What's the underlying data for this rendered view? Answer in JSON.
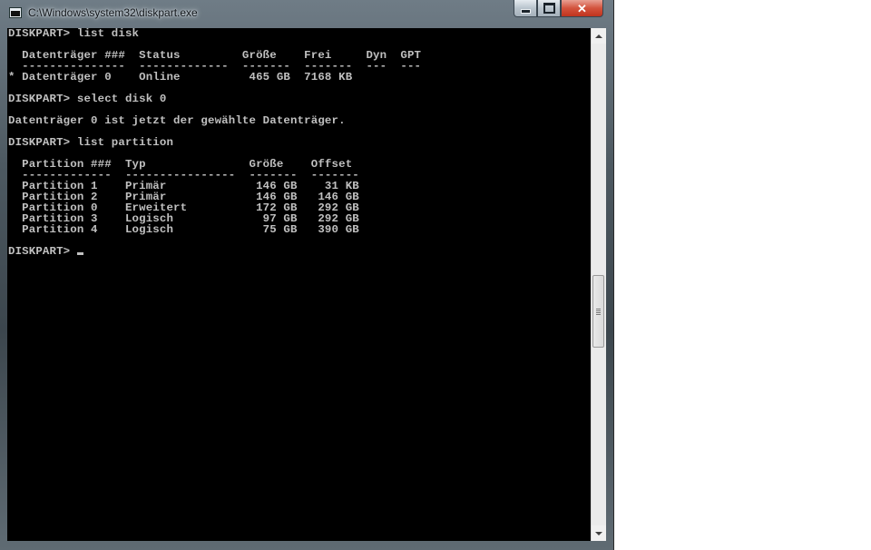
{
  "window": {
    "title": "C:\\Windows\\system32\\diskpart.exe",
    "controls": {
      "minimize": "minimize",
      "maximize": "maximize",
      "close": "✕"
    }
  },
  "console": {
    "lines": [
      "DISKPART> list disk",
      "",
      "  Datenträger ###  Status         Größe    Frei     Dyn  GPT",
      "  ---------------  -------------  -------  -------  ---  ---",
      "* Datenträger 0    Online          465 GB  7168 KB",
      "",
      "DISKPART> select disk 0",
      "",
      "Datenträger 0 ist jetzt der gewählte Datenträger.",
      "",
      "DISKPART> list partition",
      "",
      "  Partition ###  Typ               Größe    Offset",
      "  -------------  ----------------  -------  -------",
      "  Partition 1    Primär             146 GB    31 KB",
      "  Partition 2    Primär             146 GB   146 GB",
      "  Partition 0    Erweitert          172 GB   292 GB",
      "  Partition 3    Logisch             97 GB   292 GB",
      "  Partition 4    Logisch             75 GB   390 GB",
      "",
      "DISKPART> "
    ],
    "colors": {
      "background": "#000000",
      "text": "#c0c0c0"
    }
  },
  "scrollbar": {
    "up_icon": "arrow-up-icon",
    "down_icon": "arrow-down-icon"
  }
}
